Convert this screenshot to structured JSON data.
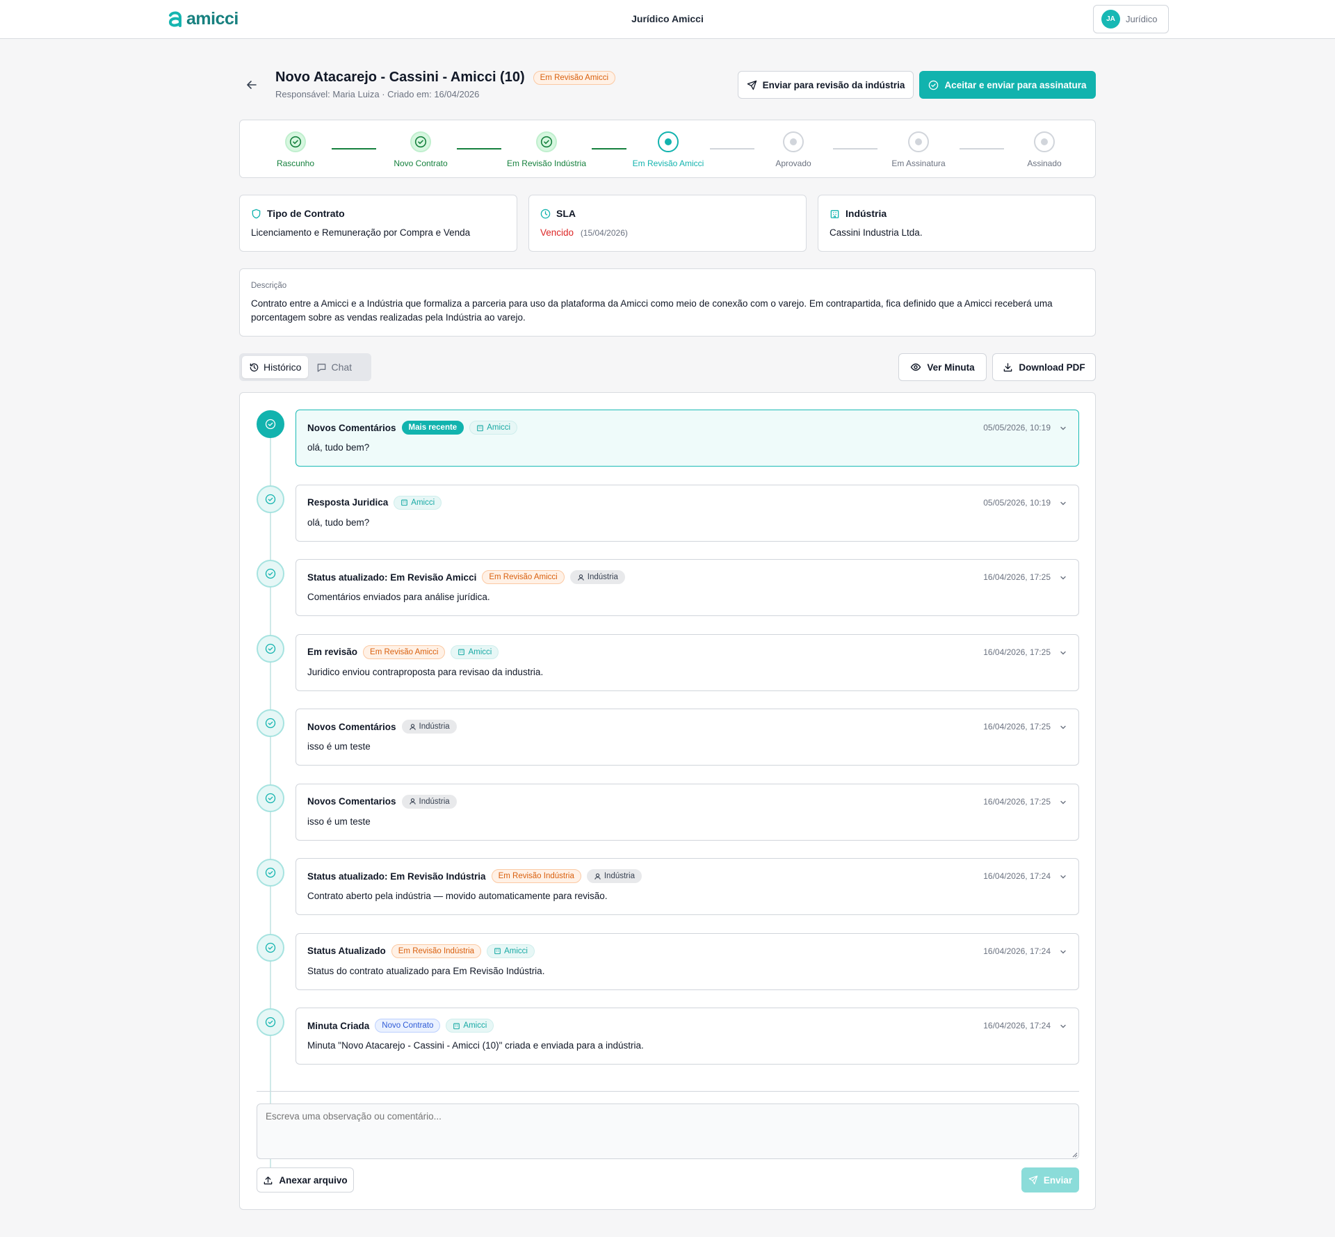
{
  "topbar": {
    "logo_text": "amicci",
    "app_title": "Jurídico Amicci",
    "user": {
      "initials": "JA",
      "role": "Jurídico"
    }
  },
  "contract": {
    "title": "Novo Atacarejo - Cassini - Amicci (10)",
    "status_badge": "Em Revisão Amicci",
    "subtitle": "Responsável: Maria Luiza · Criado em: 16/04/2026",
    "actions": {
      "send_review": "Enviar para revisão da indústria",
      "accept": "Aceitar e enviar para assinatura"
    }
  },
  "stepper": [
    {
      "label": "Rascunho",
      "state": "done"
    },
    {
      "label": "Novo Contrato",
      "state": "done"
    },
    {
      "label": "Em Revisão Indústria",
      "state": "done"
    },
    {
      "label": "Em Revisão Amicci",
      "state": "current"
    },
    {
      "label": "Aprovado",
      "state": "todo"
    },
    {
      "label": "Em Assinatura",
      "state": "todo"
    },
    {
      "label": "Assinado",
      "state": "todo"
    }
  ],
  "info": {
    "tipo": {
      "label": "Tipo de Contrato",
      "value": "Licenciamento e Remuneração por Compra e Venda"
    },
    "sla": {
      "label": "SLA",
      "status": "Vencido",
      "date": "(15/04/2026)"
    },
    "industria": {
      "label": "Indústria",
      "value": "Cassini Industria Ltda."
    }
  },
  "description": {
    "label": "Descrição",
    "text": "Contrato entre a Amicci e a Indústria que formaliza a parceria para uso da plataforma da Amicci como meio de conexão com o varejo. Em contrapartida, fica definido que a Amicci receberá uma porcentagem sobre as vendas realizadas pela Indústria ao varejo."
  },
  "tabs": {
    "historico": "Histórico",
    "chat": "Chat"
  },
  "doc_actions": {
    "ver": "Ver Minuta",
    "download": "Download PDF"
  },
  "history": [
    {
      "title": "Novos Comentários",
      "badges": [
        {
          "text": "Mais recente",
          "style": "teal"
        },
        {
          "text": "Amicci",
          "style": "tealsoft",
          "icon": "building"
        }
      ],
      "date": "05/05/2026, 10:19",
      "message": "olá, tudo bem?"
    },
    {
      "title": "Resposta Juridica",
      "badges": [
        {
          "text": "Amicci",
          "style": "tealsoft",
          "icon": "building"
        }
      ],
      "date": "05/05/2026, 10:19",
      "message": "olá, tudo bem?"
    },
    {
      "title": "Status atualizado: Em Revisão Amicci",
      "badges": [
        {
          "text": "Em Revisão Amicci",
          "style": "orange"
        },
        {
          "text": "Indústria",
          "style": "gray",
          "icon": "user"
        }
      ],
      "date": "16/04/2026, 17:25",
      "message": "Comentários enviados para análise jurídica."
    },
    {
      "title": "Em revisão",
      "badges": [
        {
          "text": "Em Revisão Amicci",
          "style": "orange"
        },
        {
          "text": "Amicci",
          "style": "tealsoft",
          "icon": "building"
        }
      ],
      "date": "16/04/2026, 17:25",
      "message": "Juridico enviou contraproposta para revisao da industria."
    },
    {
      "title": "Novos Comentários",
      "badges": [
        {
          "text": "Indústria",
          "style": "gray",
          "icon": "user"
        }
      ],
      "date": "16/04/2026, 17:25",
      "message": "isso é um teste"
    },
    {
      "title": "Novos Comentarios",
      "badges": [
        {
          "text": "Indústria",
          "style": "gray",
          "icon": "user"
        }
      ],
      "date": "16/04/2026, 17:25",
      "message": "isso é um teste"
    },
    {
      "title": "Status atualizado: Em Revisão Indústria",
      "badges": [
        {
          "text": "Em Revisão Indústria",
          "style": "orange"
        },
        {
          "text": "Indústria",
          "style": "gray",
          "icon": "user"
        }
      ],
      "date": "16/04/2026, 17:24",
      "message": "Contrato aberto pela indústria — movido automaticamente para revisão."
    },
    {
      "title": "Status Atualizado",
      "badges": [
        {
          "text": "Em Revisão Indústria",
          "style": "orange"
        },
        {
          "text": "Amicci",
          "style": "tealsoft",
          "icon": "building"
        }
      ],
      "date": "16/04/2026, 17:24",
      "message": "Status do contrato atualizado para Em Revisão Indústria."
    },
    {
      "title": "Minuta Criada",
      "badges": [
        {
          "text": "Novo Contrato",
          "style": "blue"
        },
        {
          "text": "Amicci",
          "style": "tealsoft",
          "icon": "building"
        }
      ],
      "date": "16/04/2026, 17:24",
      "message": "Minuta \"Novo Atacarejo - Cassini - Amicci (10)\" criada e enviada para a indústria."
    }
  ],
  "composer": {
    "placeholder": "Escreva uma observação ou comentário...",
    "attach": "Anexar arquivo",
    "send": "Enviar"
  },
  "colors": {
    "primary": "#12b3ae",
    "done": "#15803d",
    "overdue": "#dc2626",
    "warning": "#d9600e"
  }
}
